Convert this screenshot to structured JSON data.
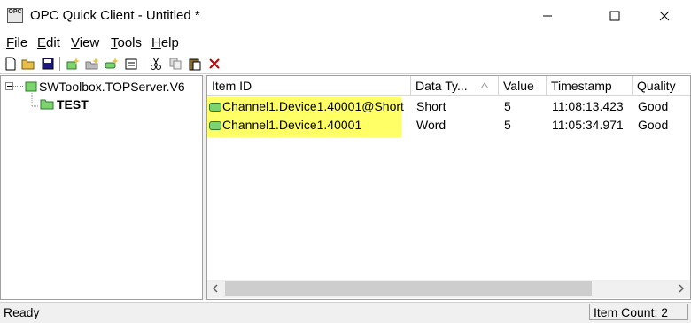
{
  "window": {
    "title": "OPC Quick Client - Untitled *",
    "app_icon_text": "OPC"
  },
  "menu": [
    "File",
    "Edit",
    "View",
    "Tools",
    "Help"
  ],
  "tree": {
    "server": "SWToolbox.TOPServer.V6",
    "group": "TEST"
  },
  "list": {
    "columns": [
      "Item ID",
      "Data Ty...",
      "Value",
      "Timestamp",
      "Quality"
    ],
    "rows": [
      {
        "item_id": "Channel1.Device1.40001@Short",
        "data_type": "Short",
        "value": "5",
        "timestamp": "11:08:13.423",
        "quality": "Good"
      },
      {
        "item_id": "Channel1.Device1.40001",
        "data_type": "Word",
        "value": "5",
        "timestamp": "11:05:34.971",
        "quality": "Good"
      }
    ],
    "highlight_color": "#ffff66"
  },
  "status": {
    "text": "Ready",
    "item_count": "Item Count: 2"
  }
}
